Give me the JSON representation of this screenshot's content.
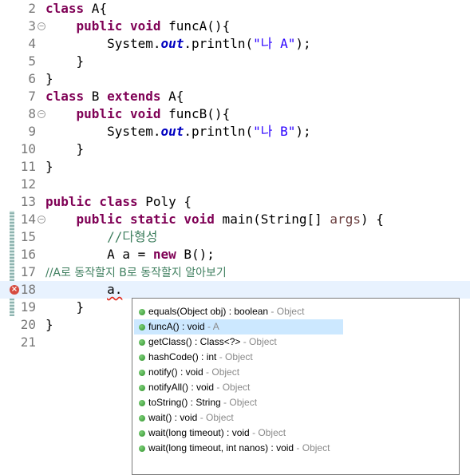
{
  "editor": {
    "lines": [
      {
        "num": "2",
        "tokens": [
          {
            "t": "class",
            "c": "kw"
          },
          {
            "t": " A{",
            "c": ""
          }
        ]
      },
      {
        "num": "3",
        "fold": "⊖",
        "tokens": [
          {
            "t": "    ",
            "c": ""
          },
          {
            "t": "public void",
            "c": "kw"
          },
          {
            "t": " funcA(){",
            "c": ""
          }
        ]
      },
      {
        "num": "4",
        "tokens": [
          {
            "t": "        System.",
            "c": ""
          },
          {
            "t": "out",
            "c": "fld"
          },
          {
            "t": ".println(",
            "c": ""
          },
          {
            "t": "\"나 A\"",
            "c": "str"
          },
          {
            "t": ");",
            "c": ""
          }
        ]
      },
      {
        "num": "5",
        "tokens": [
          {
            "t": "    }",
            "c": ""
          }
        ]
      },
      {
        "num": "6",
        "tokens": [
          {
            "t": "}",
            "c": ""
          }
        ]
      },
      {
        "num": "7",
        "tokens": [
          {
            "t": "class",
            "c": "kw"
          },
          {
            "t": " B ",
            "c": ""
          },
          {
            "t": "extends",
            "c": "kw"
          },
          {
            "t": " A{",
            "c": ""
          }
        ]
      },
      {
        "num": "8",
        "fold": "⊖",
        "tokens": [
          {
            "t": "    ",
            "c": ""
          },
          {
            "t": "public void",
            "c": "kw"
          },
          {
            "t": " funcB(){",
            "c": ""
          }
        ]
      },
      {
        "num": "9",
        "tokens": [
          {
            "t": "        System.",
            "c": ""
          },
          {
            "t": "out",
            "c": "fld"
          },
          {
            "t": ".println(",
            "c": ""
          },
          {
            "t": "\"나 B\"",
            "c": "str"
          },
          {
            "t": ");",
            "c": ""
          }
        ]
      },
      {
        "num": "10",
        "tokens": [
          {
            "t": "    }",
            "c": ""
          }
        ]
      },
      {
        "num": "11",
        "tokens": [
          {
            "t": "}",
            "c": ""
          }
        ]
      },
      {
        "num": "12",
        "tokens": []
      },
      {
        "num": "13",
        "tokens": [
          {
            "t": "public class",
            "c": "kw"
          },
          {
            "t": " Poly {",
            "c": ""
          }
        ]
      },
      {
        "num": "14",
        "fold": "⊖",
        "tokens": [
          {
            "t": "    ",
            "c": ""
          },
          {
            "t": "public static void",
            "c": "kw"
          },
          {
            "t": " main(String[] ",
            "c": ""
          },
          {
            "t": "args",
            "c": "param"
          },
          {
            "t": ") {",
            "c": ""
          }
        ]
      },
      {
        "num": "15",
        "tokens": [
          {
            "t": "        ",
            "c": ""
          },
          {
            "t": "//다형성",
            "c": "cmt"
          }
        ]
      },
      {
        "num": "16",
        "tokens": [
          {
            "t": "        A a = ",
            "c": ""
          },
          {
            "t": "new",
            "c": "kw"
          },
          {
            "t": " B();",
            "c": ""
          }
        ]
      },
      {
        "num": "17",
        "tokens": [
          {
            "t": "//A로 동작할지 B로 동작할지 알아보기",
            "c": "cmt cmt-k"
          }
        ]
      },
      {
        "num": "18",
        "error": true,
        "current": true,
        "tokens": [
          {
            "t": "        ",
            "c": ""
          },
          {
            "t": "a.",
            "c": "squiggle"
          }
        ]
      },
      {
        "num": "19",
        "tokens": [
          {
            "t": "    }",
            "c": ""
          }
        ]
      },
      {
        "num": "20",
        "tokens": [
          {
            "t": "}",
            "c": ""
          }
        ]
      },
      {
        "num": "21",
        "tokens": []
      }
    ]
  },
  "completion": {
    "selected_index": 1,
    "items": [
      {
        "label": "equals(Object obj) : boolean",
        "owner": " - Object"
      },
      {
        "label": "funcA() : void",
        "owner": " - A"
      },
      {
        "label": "getClass() : Class<?>",
        "owner": " - Object"
      },
      {
        "label": "hashCode() : int",
        "owner": " - Object"
      },
      {
        "label": "notify() : void",
        "owner": " - Object"
      },
      {
        "label": "notifyAll() : void",
        "owner": " - Object"
      },
      {
        "label": "toString() : String",
        "owner": " - Object"
      },
      {
        "label": "wait() : void",
        "owner": " - Object"
      },
      {
        "label": "wait(long timeout) : void",
        "owner": " - Object"
      },
      {
        "label": "wait(long timeout, int nanos) : void",
        "owner": " - Object"
      }
    ]
  }
}
